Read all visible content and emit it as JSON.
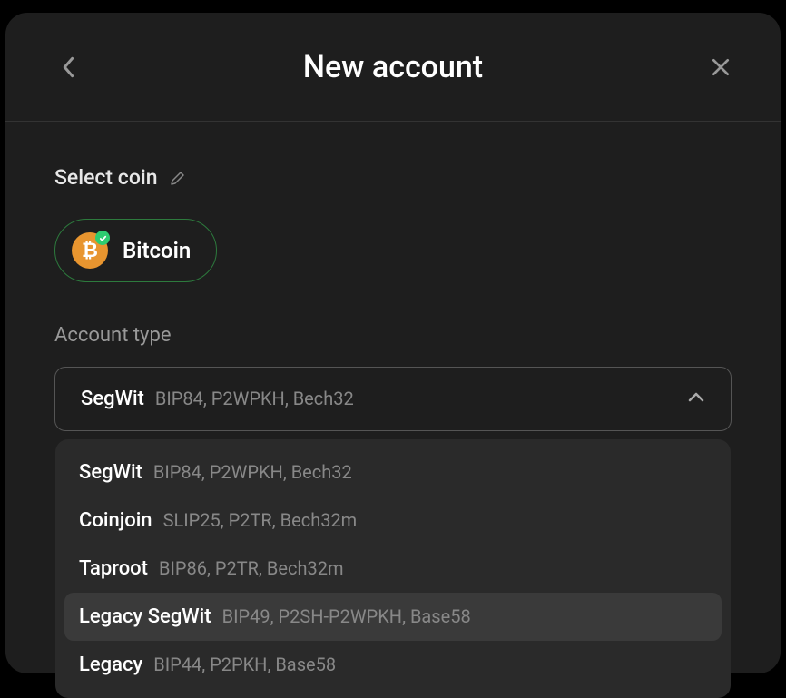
{
  "header": {
    "title": "New account"
  },
  "select_coin": {
    "label": "Select coin",
    "coin": {
      "name": "Bitcoin",
      "symbol": "₿"
    }
  },
  "account_type": {
    "label": "Account type",
    "selected": {
      "primary": "SegWit",
      "secondary": "BIP84, P2WPKH, Bech32"
    },
    "options": [
      {
        "primary": "SegWit",
        "secondary": "BIP84, P2WPKH, Bech32",
        "highlight": false
      },
      {
        "primary": "Coinjoin",
        "secondary": "SLIP25, P2TR, Bech32m",
        "highlight": false
      },
      {
        "primary": "Taproot",
        "secondary": "BIP86, P2TR, Bech32m",
        "highlight": false
      },
      {
        "primary": "Legacy SegWit",
        "secondary": "BIP49, P2SH-P2WPKH, Base58",
        "highlight": true
      },
      {
        "primary": "Legacy",
        "secondary": "BIP44, P2PKH, Base58",
        "highlight": false
      }
    ]
  }
}
